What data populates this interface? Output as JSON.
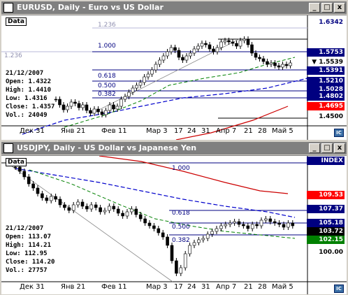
{
  "top": {
    "title": "EURUSD, Daily - Euro vs US Dollar",
    "data_label": "Data",
    "date": "21/12/2007",
    "open": "Open: 1.4322",
    "high": "High: 1.4410",
    "low": "Low: 1.4316",
    "close": "Close: 1.4357",
    "vol": "Vol.: 24049",
    "fib": [
      "1.236",
      "1.000",
      "0.618",
      "0.500",
      "0.382",
      "1.236"
    ],
    "prices": [
      "1.6342",
      "1.5753",
      "1.5539",
      "1.5391",
      "1.5210",
      "1.5028",
      "1.4802",
      "1.4695",
      "1.4500"
    ],
    "xlabels": [
      "Дек 31",
      "Янв 21",
      "Фев 11",
      "Мар 3",
      "17",
      "24",
      "31",
      "Апр 7",
      "21",
      "28",
      "Май 5"
    ],
    "current_marker": "▼",
    "current_price": "1.5539"
  },
  "bottom": {
    "title": "USDJPY, Daily - US Dollar vs Japanese Yen",
    "data_label": "Data",
    "index_label": "INDEX",
    "date": "21/12/2007",
    "open": "Open: 113.07",
    "high": "High: 114.21",
    "low": "Low: 112.95",
    "close": "Close: 114.20",
    "vol": "Vol.: 27757",
    "fib": [
      "1.000",
      "0.618",
      "0.500",
      "0.382"
    ],
    "prices": [
      "109.53",
      "107.37",
      "105.18",
      "103.72",
      "102.15",
      "100.00"
    ],
    "xlabels": [
      "Дек 31",
      "Янв 21",
      "Фев 11",
      "Мар 3",
      "17",
      "24",
      "31",
      "Апр 7",
      "21",
      "28",
      "Май 5"
    ],
    "current_price": "103.72"
  },
  "window_buttons": {
    "minimize": "_",
    "maximize": "□",
    "close": "x"
  },
  "corner_button": "IC",
  "colors": {
    "title_bg": "#808080",
    "price_blue": "#000080",
    "price_red": "#ff0000",
    "price_green": "#008000",
    "ma_blue": "#0000cc",
    "ma_red": "#cc0000",
    "ma_green": "#008000"
  }
}
